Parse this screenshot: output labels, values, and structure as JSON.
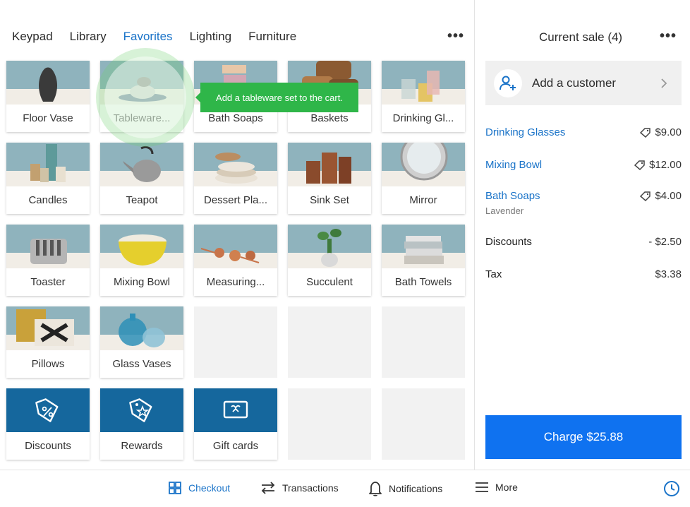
{
  "tabs": [
    {
      "label": "Keypad",
      "active": false
    },
    {
      "label": "Library",
      "active": false
    },
    {
      "label": "Favorites",
      "active": true
    },
    {
      "label": "Lighting",
      "active": false
    },
    {
      "label": "Furniture",
      "active": false
    }
  ],
  "more_glyph": "•••",
  "grid": {
    "tiles": [
      {
        "label": "Floor Vase"
      },
      {
        "label": "Tableware..."
      },
      {
        "label": "Bath Soaps"
      },
      {
        "label": "Baskets"
      },
      {
        "label": "Drinking Gl..."
      },
      {
        "label": "Candles"
      },
      {
        "label": "Teapot"
      },
      {
        "label": "Dessert Pla..."
      },
      {
        "label": "Sink Set"
      },
      {
        "label": "Mirror"
      },
      {
        "label": "Toaster"
      },
      {
        "label": "Mixing Bowl"
      },
      {
        "label": "Measuring..."
      },
      {
        "label": "Succulent"
      },
      {
        "label": "Bath Towels"
      },
      {
        "label": "Pillows"
      },
      {
        "label": "Glass Vases"
      },
      {
        "label": "Discounts"
      },
      {
        "label": "Rewards"
      },
      {
        "label": "Gift cards"
      }
    ]
  },
  "tooltip": "Add a tableware set to the cart.",
  "sale": {
    "title": "Current sale (4)",
    "customer_label": "Add a customer",
    "items": [
      {
        "name": "Drinking Glasses",
        "price": "$9.00"
      },
      {
        "name": "Mixing Bowl",
        "price": "$12.00"
      },
      {
        "name": "Bath Soaps",
        "price": "$4.00",
        "variant": "Lavender"
      }
    ],
    "discounts_label": "Discounts",
    "discounts_value": "- $2.50",
    "tax_label": "Tax",
    "tax_value": "$3.38",
    "charge_label": "Charge $25.88"
  },
  "bottom_nav": [
    {
      "label": "Checkout",
      "icon": "grid-icon",
      "active": true
    },
    {
      "label": "Transactions",
      "icon": "swap-arrows-icon",
      "active": false
    },
    {
      "label": "Notifications",
      "icon": "bell-icon",
      "active": false
    },
    {
      "label": "More",
      "icon": "menu-icon",
      "active": false
    }
  ],
  "colors": {
    "accent": "#1a73c8",
    "charge": "#0f72f0",
    "tile_blue": "#15679d",
    "tooltip_green": "#2fb649",
    "photo_wall": "#8fb3bd"
  }
}
